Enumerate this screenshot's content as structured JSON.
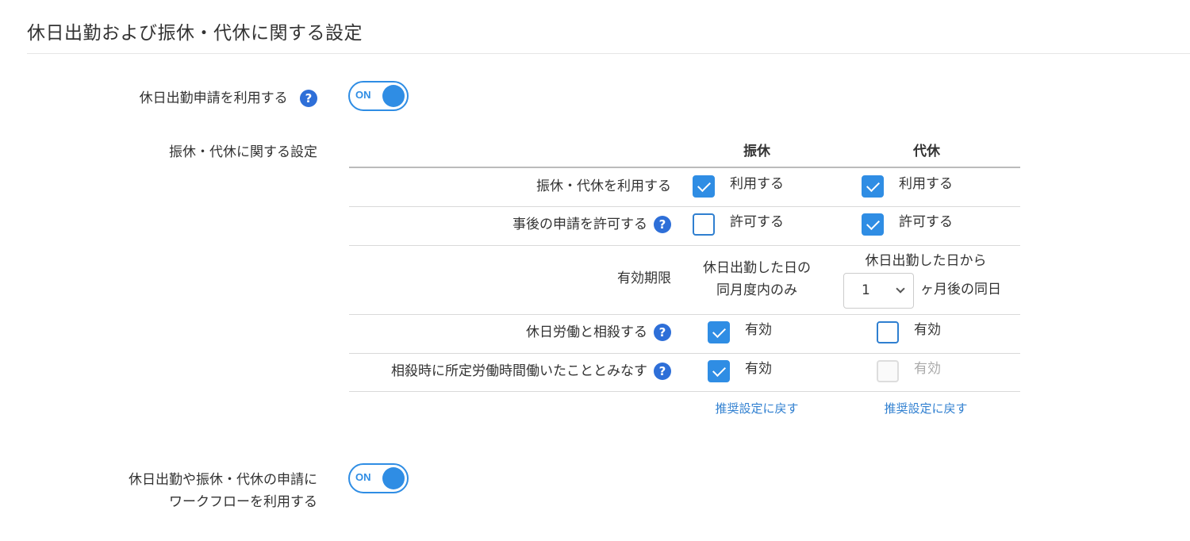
{
  "section_title": "休日出勤および振休・代休に関する設定",
  "holiday_work": {
    "label": "休日出勤申請を利用する",
    "help": "?",
    "toggle": "ON"
  },
  "substitute": {
    "label": "振休・代休に関する設定",
    "columns": [
      "振休",
      "代休"
    ],
    "rows": {
      "use": {
        "label": "振休・代休を利用する",
        "furikyu": {
          "checked": true,
          "text": "利用する"
        },
        "daikyu": {
          "checked": true,
          "text": "利用する"
        }
      },
      "after": {
        "label": "事後の申請を許可する",
        "help": "?",
        "furikyu": {
          "checked": false,
          "text": "許可する"
        },
        "daikyu": {
          "checked": true,
          "text": "許可する"
        }
      },
      "validity": {
        "label": "有効期限",
        "furikyu_line1": "休日出勤した日の",
        "furikyu_line2": "同月度内のみ",
        "daikyu_line1": "休日出勤した日から",
        "daikyu_select": "1",
        "daikyu_suffix": "ヶ月後の同日"
      },
      "offset": {
        "label": "休日労働と相殺する",
        "help": "?",
        "furikyu": {
          "checked": true,
          "text": "有効"
        },
        "daikyu": {
          "checked": false,
          "text": "有効"
        }
      },
      "deemed": {
        "label": "相殺時に所定労働時間働いたこととみなす",
        "help": "?",
        "furikyu": {
          "checked": true,
          "text": "有効"
        },
        "daikyu": {
          "checked": false,
          "disabled": true,
          "text": "有効"
        }
      }
    },
    "reset_label": "推奨設定に戻す"
  },
  "workflow": {
    "label_line1": "休日出勤や振休・代休の申請に",
    "label_line2": "ワークフローを利用する",
    "toggle": "ON"
  },
  "colors": {
    "accent": "#2f8de4",
    "help": "#2e6fd8",
    "link": "#2f7fd0"
  }
}
